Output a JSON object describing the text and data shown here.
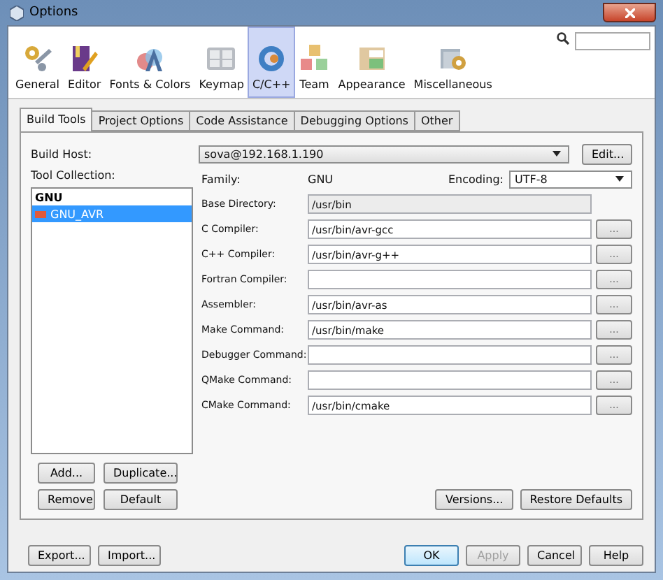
{
  "window": {
    "title": "Options"
  },
  "categories": [
    {
      "label": "General",
      "selected": false
    },
    {
      "label": "Editor",
      "selected": false
    },
    {
      "label": "Fonts & Colors",
      "selected": false
    },
    {
      "label": "Keymap",
      "selected": false
    },
    {
      "label": "C/C++",
      "selected": true
    },
    {
      "label": "Team",
      "selected": false
    },
    {
      "label": "Appearance",
      "selected": false
    },
    {
      "label": "Miscellaneous",
      "selected": false
    }
  ],
  "tabs": [
    {
      "label": "Build Tools",
      "selected": true
    },
    {
      "label": "Project Options",
      "selected": false
    },
    {
      "label": "Code Assistance",
      "selected": false
    },
    {
      "label": "Debugging Options",
      "selected": false
    },
    {
      "label": "Other",
      "selected": false
    }
  ],
  "build_host": {
    "label": "Build Host:",
    "value": "sova@192.168.1.190",
    "button": "Edit..."
  },
  "tool_collection": {
    "label": "Tool Collection:",
    "items": [
      {
        "label": "GNU",
        "default": true,
        "selected": false
      },
      {
        "label": "GNU_AVR",
        "default": false,
        "selected": true
      }
    ],
    "buttons": [
      "Add...",
      "Duplicate...",
      "Remove",
      "Default"
    ]
  },
  "family": {
    "label": "Family:",
    "value": "GNU"
  },
  "encoding": {
    "label": "Encoding:",
    "value": "UTF-8"
  },
  "fields": [
    {
      "label": "Base Directory:",
      "value": "/usr/bin",
      "editable": false
    },
    {
      "label": "C Compiler:",
      "value": "/usr/bin/avr-gcc",
      "editable": true,
      "browse": "..."
    },
    {
      "label": "C++ Compiler:",
      "value": "/usr/bin/avr-g++",
      "editable": true,
      "browse": "..."
    },
    {
      "label": "Fortran Compiler:",
      "editable": true,
      "browse": "..."
    },
    {
      "label": "Assembler:",
      "value": "/usr/bin/avr-as",
      "editable": true,
      "browse": "..."
    },
    {
      "label": "Make Command:",
      "value": "/usr/bin/make",
      "editable": true,
      "browse": "..."
    },
    {
      "label": "Debugger Command:",
      "editable": true,
      "browse": "..."
    },
    {
      "label": "QMake Command:",
      "editable": true,
      "browse": "..."
    },
    {
      "label": "CMake Command:",
      "value": "/usr/bin/cmake",
      "editable": true,
      "browse": "..."
    }
  ],
  "panel_buttons": [
    "Versions...",
    "Restore Defaults"
  ],
  "footer_left": [
    "Export...",
    "Import..."
  ],
  "footer_right": [
    {
      "label": "OK",
      "disabled": false,
      "default": true
    },
    {
      "label": "Apply",
      "disabled": true,
      "default": false
    },
    {
      "label": "Cancel",
      "disabled": false,
      "default": false
    },
    {
      "label": "Help",
      "disabled": false,
      "default": false
    }
  ]
}
